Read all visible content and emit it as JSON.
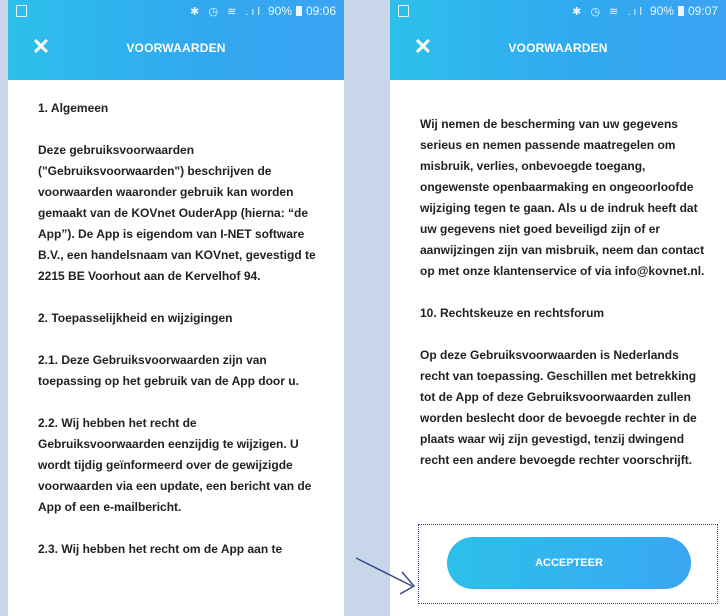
{
  "status_bar": {
    "icons": "✱ ◷ ≋ .ıl",
    "battery": "90%",
    "time_left": "09:06",
    "time_right": "09:07"
  },
  "header": {
    "title": "VOORWAARDEN",
    "close_icon": "close-icon"
  },
  "left_screen": {
    "paragraphs": [
      "1. Algemeen",
      "Deze gebruiksvoorwaarden (\"Gebruiksvoorwaarden\") beschrijven de voorwaarden waaronder gebruik kan worden gemaakt van de KOVnet OuderApp (hierna: “de App”). De App is eigendom van I-NET software B.V., een handelsnaam van KOVnet, gevestigd te 2215 BE Voorhout aan de Kervelhof 94.",
      "2. Toepasselijkheid en wijzigingen",
      "2.1. Deze Gebruiksvoorwaarden zijn van toepassing op het gebruik van de App door u.",
      "2.2. Wij hebben het recht de Gebruiksvoorwaarden eenzijdig te wijzigen. U wordt tijdig geïnformeerd over de gewijzigde voorwaarden via een update, een bericht van de App of een e-mailbericht.",
      "2.3. Wij hebben het recht om de App aan te"
    ]
  },
  "right_screen": {
    "paragraphs": [
      "Wij nemen de bescherming van uw gegevens serieus en nemen passende maatregelen om misbruik, verlies, onbevoegde toegang, ongewenste openbaarmaking en ongeoorloofde wijziging tegen te gaan. Als u de indruk heeft dat uw gegevens niet goed beveiligd zijn of er aanwijzingen zijn van misbruik, neem dan contact op met onze klantenservice of via info@kovnet.nl.",
      "10. Rechtskeuze en rechtsforum",
      "Op deze Gebruiksvoorwaarden is Nederlands recht van toepassing. Geschillen met betrekking tot de App of deze Gebruiksvoorwaarden zullen worden beslecht door de bevoegde rechter in de plaats waar wij zijn gevestigd, tenzij dwingend recht een andere bevoegde rechter voorschrijft."
    ],
    "accept_label": "ACCEPTEER"
  },
  "colors": {
    "accent_start": "#2cc0ea",
    "accent_end": "#3aa6f3",
    "page_background": "#c8d8ea",
    "annotation": "#3a4a8a"
  }
}
